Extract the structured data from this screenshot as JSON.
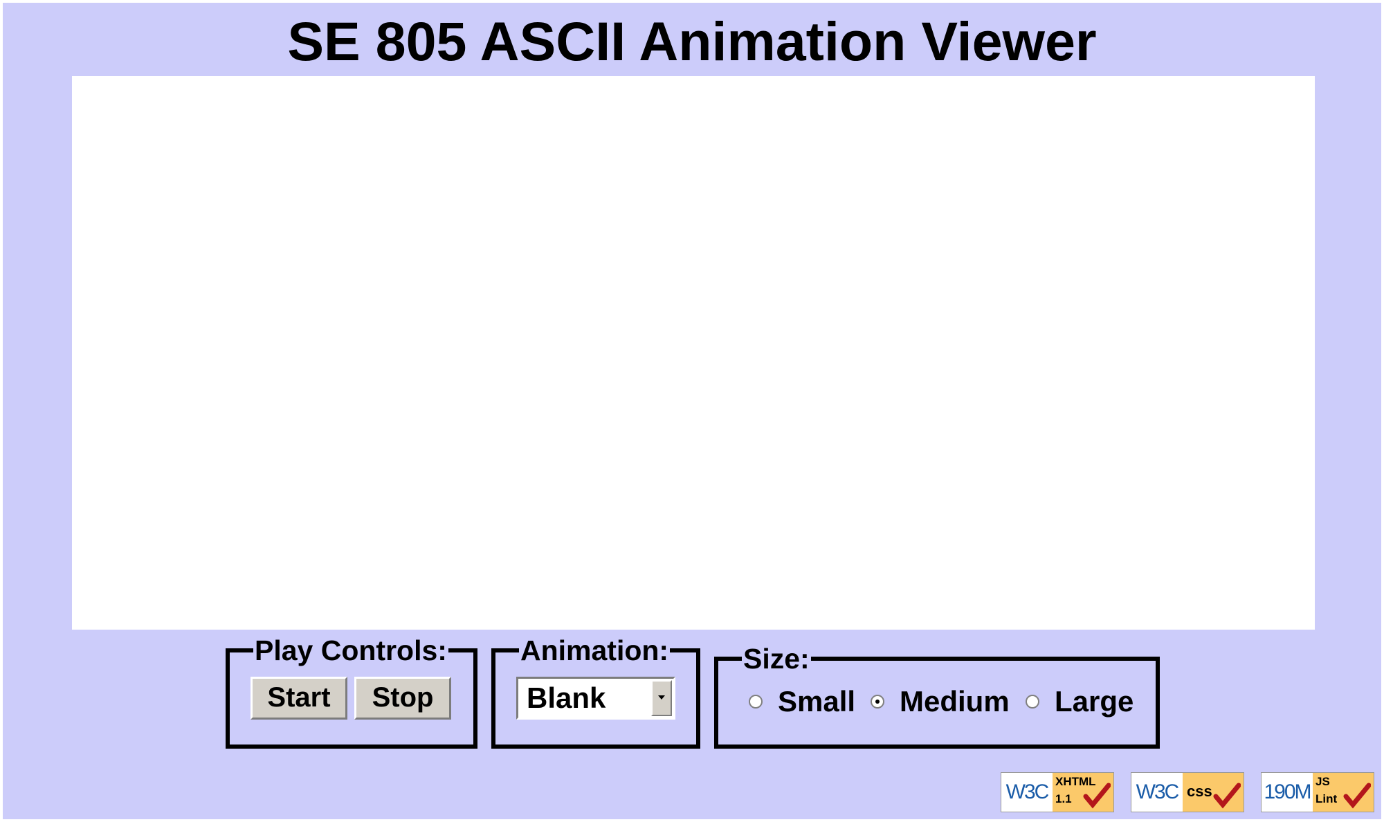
{
  "page": {
    "title": "SE 805 ASCII Animation Viewer",
    "background_color": "#ccccfa",
    "display_area_color": "#ffffff"
  },
  "play_controls": {
    "legend": "Play Controls:",
    "start_label": "Start",
    "stop_label": "Stop"
  },
  "animation": {
    "legend": "Animation:",
    "selected": "Blank"
  },
  "size": {
    "legend": "Size:",
    "options": [
      {
        "label": "Small",
        "checked": false
      },
      {
        "label": "Medium",
        "checked": true
      },
      {
        "label": "Large",
        "checked": false
      }
    ]
  },
  "badges": [
    {
      "left": "W3C",
      "line1": "XHTML",
      "line2": "1.1",
      "icon": "check-icon"
    },
    {
      "left": "W3C",
      "line1": "css",
      "icon": "check-icon"
    },
    {
      "left": "190M",
      "line1": "JS",
      "line2": "Lint",
      "icon": "check-icon"
    }
  ]
}
